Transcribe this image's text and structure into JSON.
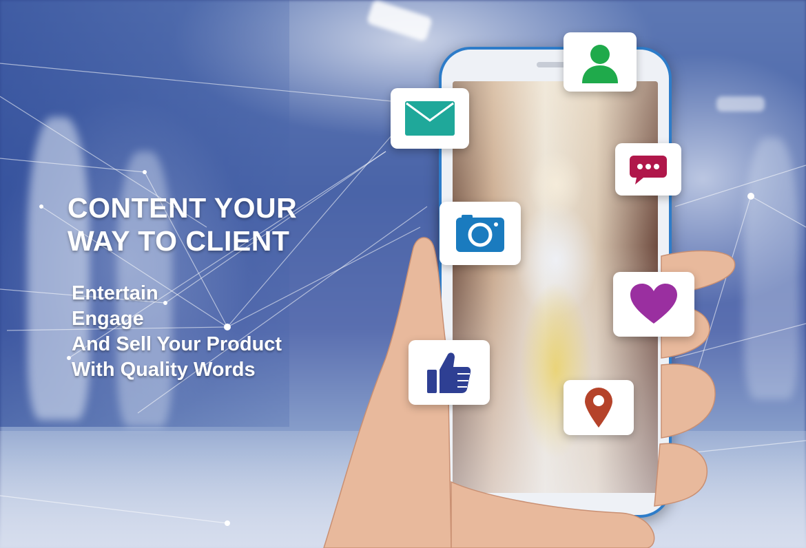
{
  "headline": {
    "line1": "CONTENT YOUR",
    "line2": "WAY TO CLIENT"
  },
  "tagline": [
    "Entertain",
    "Engage",
    "And Sell Your Product",
    "With Quality Words"
  ],
  "icons": [
    "user-icon",
    "mail-icon",
    "chat-icon",
    "camera-icon",
    "heart-icon",
    "thumbs-up-icon",
    "location-pin-icon"
  ],
  "colors": {
    "user": "#1faa4b",
    "mail": "#1fa89a",
    "chat": "#b0174a",
    "camera": "#1a7bbf",
    "heart": "#9a2fa0",
    "thumbs_up": "#2e3f93",
    "location": "#b5432a",
    "phone_frame": "#2d7cc9"
  }
}
